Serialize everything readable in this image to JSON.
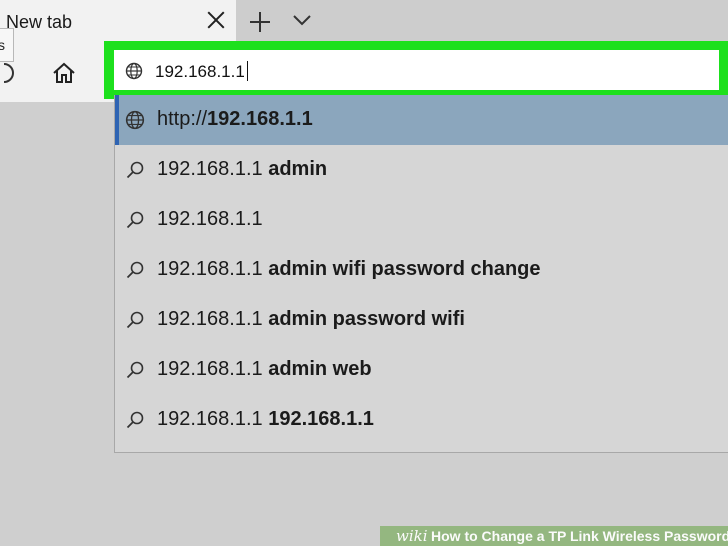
{
  "tab": {
    "title": "New tab"
  },
  "toolbar": {
    "tooltip_fragment": "s"
  },
  "address_bar": {
    "value": "192.168.1.1"
  },
  "suggestions": [
    {
      "prefix": "http://",
      "bold": "192.168.1.1",
      "icon": "globe-icon",
      "selected": true
    },
    {
      "prefix": "192.168.1.1 ",
      "bold": "admin",
      "icon": "search-icon",
      "selected": false
    },
    {
      "prefix": "192.168.1.1",
      "bold": "",
      "icon": "search-icon",
      "selected": false
    },
    {
      "prefix": "192.168.1.1 ",
      "bold": "admin wifi password change",
      "icon": "search-icon",
      "selected": false
    },
    {
      "prefix": "192.168.1.1 ",
      "bold": "admin password wifi",
      "icon": "search-icon",
      "selected": false
    },
    {
      "prefix": "192.168.1.1 ",
      "bold": "admin web",
      "icon": "search-icon",
      "selected": false
    },
    {
      "prefix": "192.168.1.1 ",
      "bold": "192.168.1.1",
      "icon": "search-icon",
      "selected": false
    }
  ],
  "watermark": {
    "logo": "wiki",
    "text": "How to Change a TP Link Wireless Password"
  },
  "colors": {
    "highlight": "#1de01d",
    "selected_row": "#8ba6bd",
    "selected_bar": "#2f64b3"
  }
}
